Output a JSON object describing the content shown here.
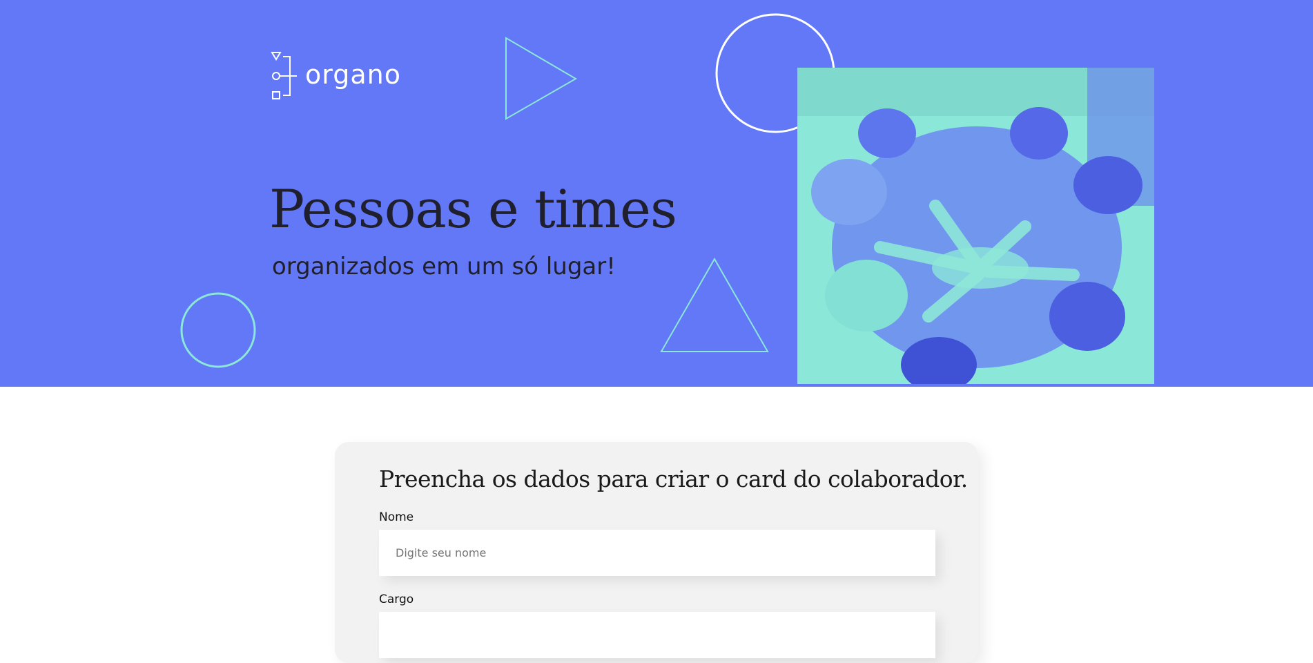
{
  "brand": {
    "name": "organo"
  },
  "hero": {
    "title": "Pessoas e times",
    "subtitle": "organizados em um só lugar!",
    "photo_alt": "",
    "colors": {
      "background": "#6278f7",
      "shape_outline": "#8be7d8",
      "photo_tint": "#8be7d8"
    }
  },
  "form": {
    "title": "Preencha os dados para criar o card do colaborador.",
    "fields": [
      {
        "label": "Nome",
        "placeholder": "Digite seu nome",
        "value": ""
      },
      {
        "label": "Cargo",
        "placeholder": "",
        "value": ""
      }
    ]
  },
  "decorations": {
    "icons": [
      "logo-icon",
      "triangle-outline",
      "circle-outline"
    ]
  }
}
